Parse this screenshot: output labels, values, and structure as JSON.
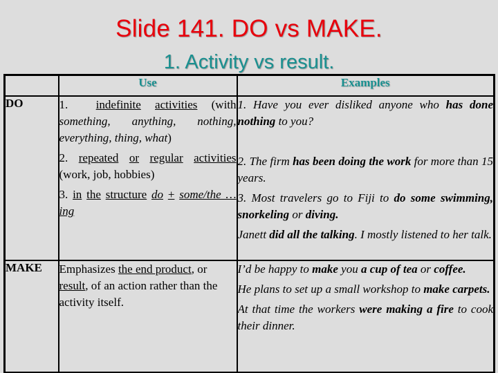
{
  "slide": {
    "title": "Slide 141. DO vs MAKE.",
    "subtitle": "1. Activity vs result.",
    "colors": {
      "title": "#e8000b",
      "subtitle": "#1a9090",
      "header": "#1a9090",
      "background": "#dddddd"
    }
  },
  "table": {
    "headers": [
      "",
      "Use",
      "Examples"
    ],
    "rows": [
      {
        "label": "DO",
        "use": {
          "item1": {
            "num": "1.",
            "u1": "indefinite",
            "u2": "activities",
            "rest": " (with ",
            "italic": "something, anything, nothing, everything, thing, what",
            "close": ")"
          },
          "item2": {
            "num": "2.",
            "u1": "repeated",
            "u2": "or",
            "u3": "regular",
            "u4": "activities",
            "rest": " (work, job, hobbies)"
          },
          "item3": {
            "num": "3.",
            "u1": "in",
            "u2": "the",
            "u3": "structure",
            "ui1": "do",
            "plus": "+",
            "ui2": "some/the … ing"
          }
        },
        "examples": {
          "ex1": {
            "a": "1. Have you ever disliked anyone who ",
            "b": "has done nothing",
            "c": " to you?"
          },
          "ex2": {
            "a": "2. The firm ",
            "b": "has been doing the work",
            "c": " for more than 15 years."
          },
          "ex3": {
            "a": "3. Most travelers go to Fiji to ",
            "b": "do some swimming, snorkeling",
            "c": " or ",
            "d": "diving."
          },
          "ex4": {
            "a": "Janett ",
            "b": "did all the talking",
            "c": ". I mostly listened to her talk."
          }
        }
      },
      {
        "label": "MAKE",
        "use": {
          "a": "Emphasizes ",
          "u1": "the end product",
          "b": ", or ",
          "u2": "result",
          "c": ", of an action rather than the activity itself."
        },
        "examples": {
          "ex1": {
            "a": "I’d be happy to ",
            "b": "make",
            "c": " you ",
            "d": "a cup of tea",
            "e": " or ",
            "f": "coffee."
          },
          "ex2": {
            "a": "He plans to set up a small workshop to ",
            "b": "make carpets."
          },
          "ex3": {
            "a": "At that time the workers ",
            "b": "were making a fire",
            "c": " to cook their dinner."
          }
        }
      }
    ]
  }
}
